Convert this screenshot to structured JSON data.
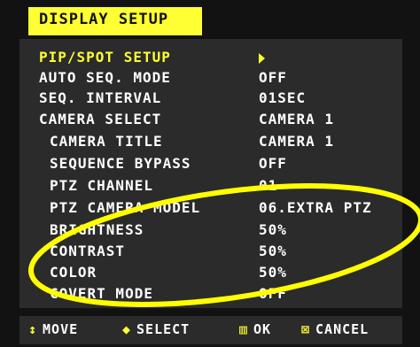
{
  "title": "DISPLAY SETUP",
  "menu": [
    {
      "label": "PIP/SPOT SETUP",
      "value": "",
      "submenu": true,
      "highlight": true
    },
    {
      "label": "AUTO SEQ. MODE",
      "value": "OFF"
    },
    {
      "label": "SEQ. INTERVAL",
      "value": "01SEC"
    },
    {
      "label": "CAMERA SELECT",
      "value": "CAMERA 1"
    },
    {
      "label": "CAMERA TITLE",
      "value": "CAMERA 1",
      "indent": true
    },
    {
      "label": "SEQUENCE BYPASS",
      "value": "OFF",
      "indent": true
    },
    {
      "label": "PTZ CHANNEL",
      "value": "01",
      "indent": true
    },
    {
      "label": "PTZ CAMERA MODEL",
      "value": "06.EXTRA PTZ",
      "indent": true
    },
    {
      "label": "BRIGHTNESS",
      "value": "50%",
      "indent": true
    },
    {
      "label": "CONTRAST",
      "value": "50%",
      "indent": true
    },
    {
      "label": "COLOR",
      "value": "50%",
      "indent": true
    },
    {
      "label": "COVERT MODE",
      "value": "OFF",
      "indent": true
    }
  ],
  "footer": {
    "move": {
      "icon": "up-down-arrow-icon",
      "glyph": "↕",
      "label": "MOVE"
    },
    "select": {
      "icon": "left-right-arrow-icon",
      "glyph": "◆",
      "label": "SELECT"
    },
    "ok": {
      "icon": "ok-square-icon",
      "glyph": "▥",
      "label": "OK"
    },
    "cancel": {
      "icon": "cancel-box-icon",
      "glyph": "⊠",
      "label": "CANCEL"
    }
  },
  "colors": {
    "accent": "#ffff33",
    "panel": "#2b2b2b",
    "background": "#121212",
    "annotation": "#ffff00"
  }
}
